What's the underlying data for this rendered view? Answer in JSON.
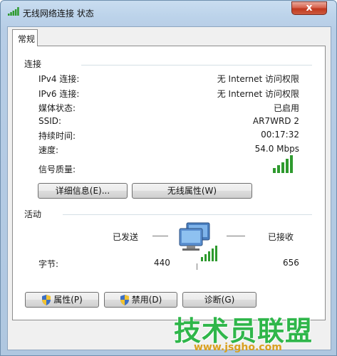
{
  "window": {
    "title": "无线网络连接 状态",
    "close_glyph": "x"
  },
  "tabs": [
    {
      "label": "常规"
    }
  ],
  "connection": {
    "section_title": "连接",
    "rows": [
      {
        "label": "IPv4 连接:",
        "value": "无 Internet 访问权限"
      },
      {
        "label": "IPv6 连接:",
        "value": "无 Internet 访问权限"
      },
      {
        "label": "媒体状态:",
        "value": "已启用"
      },
      {
        "label": "SSID:",
        "value": "AR7WRD 2"
      },
      {
        "label": "持续时间:",
        "value": "00:17:32"
      },
      {
        "label": "速度:",
        "value": "54.0 Mbps"
      }
    ],
    "signal_label": "信号质量:",
    "signal_bars_lit": 5,
    "signal_bars_total": 5,
    "details_button": "详细信息(E)...",
    "wireless_props_button": "无线属性(W)"
  },
  "activity": {
    "section_title": "活动",
    "sent_label": "已发送",
    "received_label": "已接收",
    "bytes_label": "字节:",
    "bytes_sent": "440",
    "bytes_received": "656"
  },
  "buttons": {
    "properties": "属性(P)",
    "disable": "禁用(D)",
    "diagnose": "诊断(G)"
  },
  "watermark": {
    "brand": "技术员联盟",
    "url": "www.jsgho.com"
  },
  "colors": {
    "signal_green": "#2e9a2e",
    "brand_green": "#2fb64a"
  }
}
